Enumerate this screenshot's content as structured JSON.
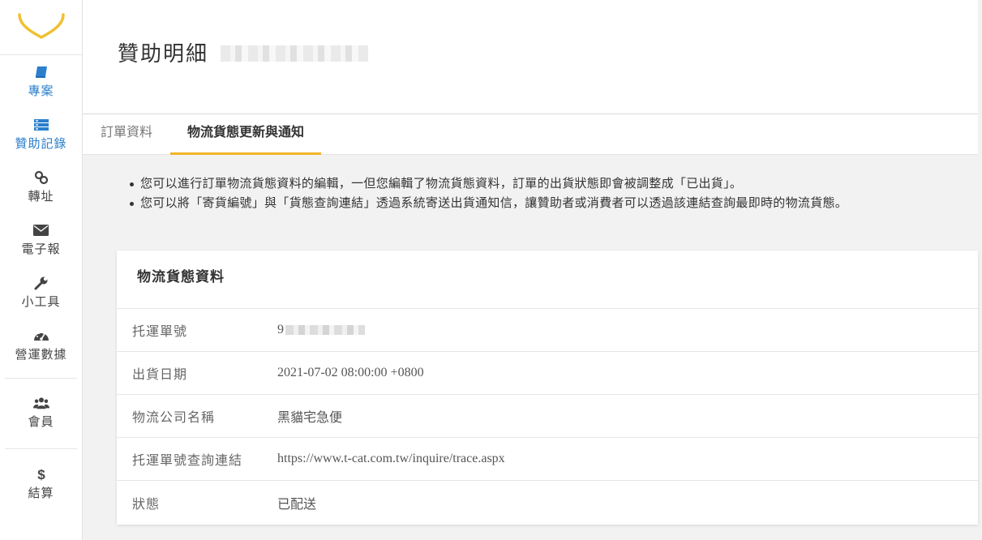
{
  "sidebar": {
    "items": [
      {
        "label": "專案",
        "icon": "book-icon",
        "active": false
      },
      {
        "label": "贊助記錄",
        "icon": "list-icon",
        "active": true
      },
      {
        "label": "轉址",
        "icon": "link-icon",
        "active": false
      },
      {
        "label": "電子報",
        "icon": "envelope-icon",
        "active": false
      },
      {
        "label": "小工具",
        "icon": "wrench-icon",
        "active": false
      },
      {
        "label": "營運數據",
        "icon": "dashboard-icon",
        "active": false
      },
      {
        "label": "會員",
        "icon": "users-icon",
        "active": false
      },
      {
        "label": "結算",
        "icon": "dollar-icon",
        "active": false
      }
    ]
  },
  "header": {
    "title": "贊助明細"
  },
  "tabs": [
    {
      "label": "訂單資料",
      "active": false
    },
    {
      "label": "物流貨態更新與通知",
      "active": true
    }
  ],
  "notes": [
    "您可以進行訂單物流貨態資料的編輯，一但您編輯了物流貨態資料，訂單的出貨狀態即會被調整成「已出貨」。",
    "您可以將「寄貨編號」與「貨態查詢連結」透過系統寄送出貨通知信，讓贊助者或消費者可以透過該連結查詢最即時的物流貨態。"
  ],
  "card": {
    "title": "物流貨態資料",
    "rows": [
      {
        "label": "托運單號",
        "value": "9"
      },
      {
        "label": "出貨日期",
        "value": "2021-07-02 08:00:00 +0800"
      },
      {
        "label": "物流公司名稱",
        "value": "黑貓宅急便"
      },
      {
        "label": "托運單號查詢連結",
        "value": "https://www.t-cat.com.tw/inquire/trace.aspx"
      },
      {
        "label": "狀態",
        "value": "已配送"
      }
    ]
  },
  "colors": {
    "accent": "#f0b428",
    "active_nav": "#2b7fcc",
    "logo": "#f0c030"
  }
}
